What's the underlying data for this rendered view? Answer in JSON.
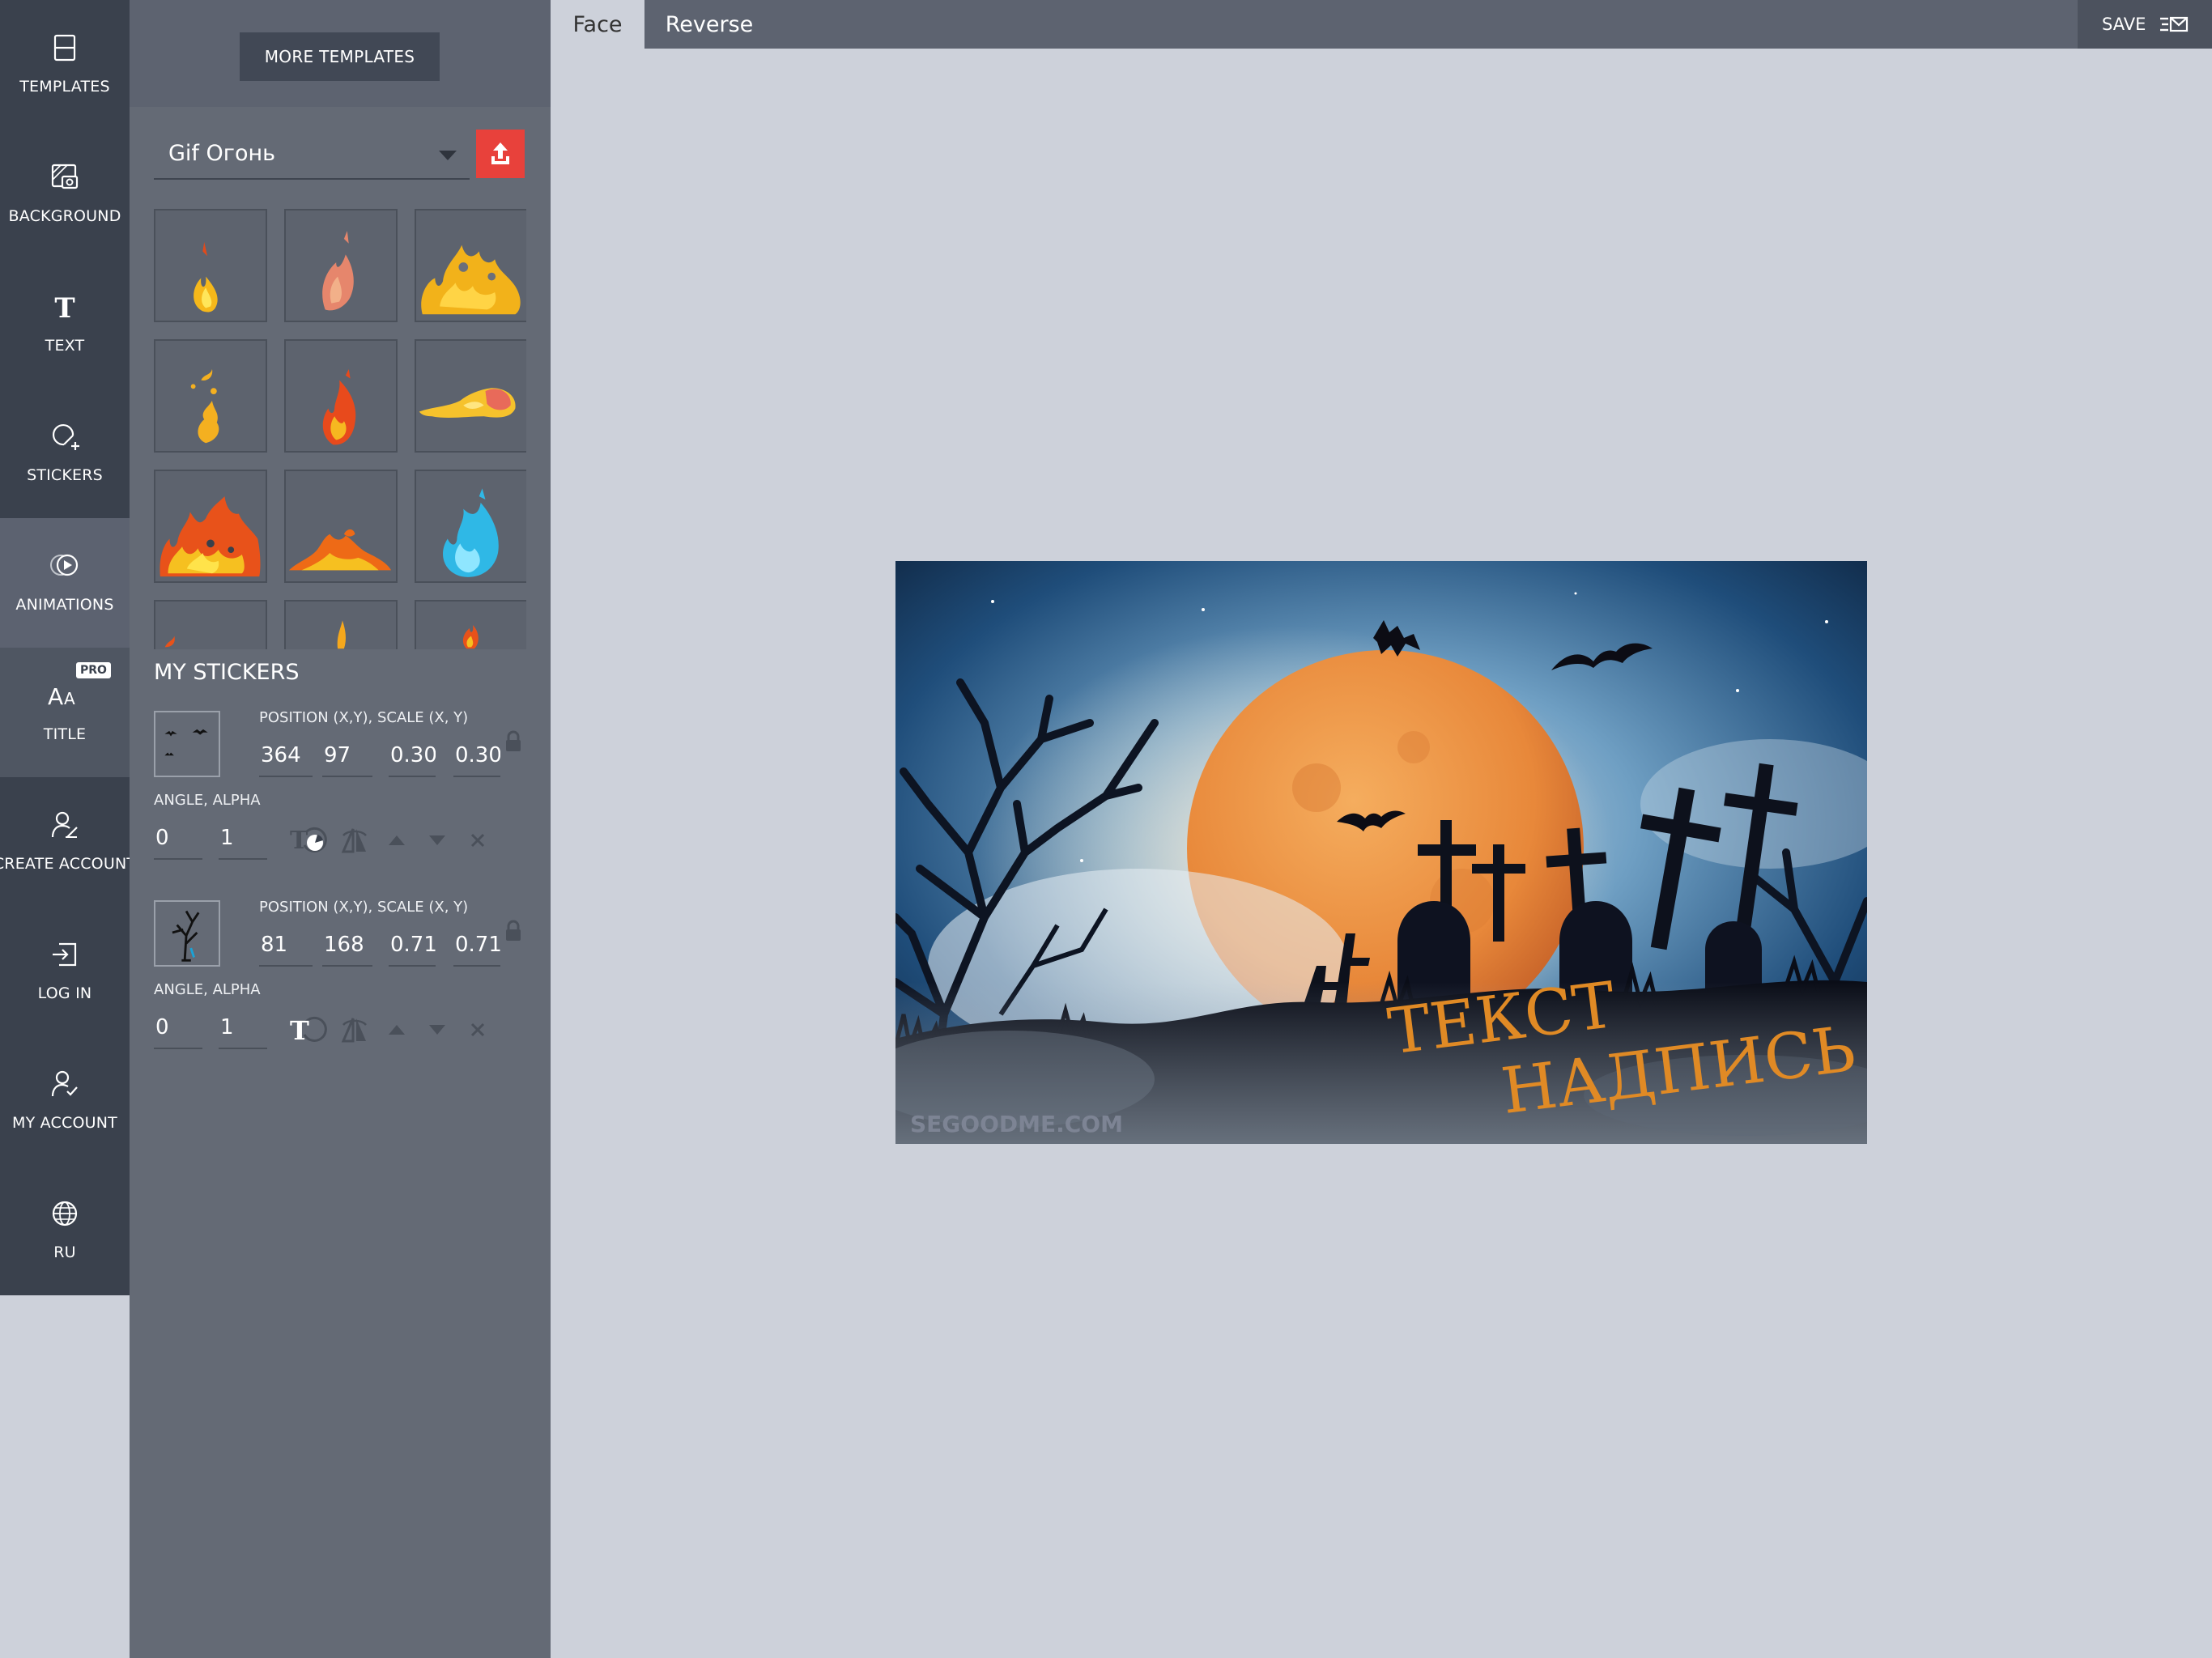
{
  "rail": {
    "items": [
      {
        "label": "TEMPLATES",
        "icon": "templates-icon"
      },
      {
        "label": "BACKGROUND",
        "icon": "background-icon"
      },
      {
        "label": "TEXT",
        "icon": "text-icon"
      },
      {
        "label": "STICKERS",
        "icon": "stickers-icon"
      },
      {
        "label": "ANIMATIONS",
        "icon": "animations-icon",
        "active": true
      },
      {
        "label": "TITLE",
        "icon": "title-icon",
        "badge": "PRO"
      },
      {
        "label": "CREATE ACCOUNT",
        "icon": "create-account-icon"
      },
      {
        "label": "LOG IN",
        "icon": "login-icon"
      },
      {
        "label": "MY ACCOUNT",
        "icon": "my-account-icon"
      },
      {
        "label": "RU",
        "icon": "globe-icon"
      }
    ]
  },
  "panel": {
    "more_templates": "MORE TEMPLATES",
    "category": "Gif Огонь",
    "upload_icon": "upload-icon",
    "thumbnails": [
      "fire-sticker-1",
      "fire-sticker-2",
      "fire-sticker-3",
      "fire-sticker-4",
      "fire-sticker-5",
      "fire-sticker-6",
      "fire-sticker-7",
      "fire-sticker-8",
      "fire-sticker-9",
      "fire-sticker-10",
      "fire-sticker-11",
      "fire-sticker-12"
    ],
    "my_stickers_title": "MY STICKERS",
    "stickers": [
      {
        "preview": "bats-sticker",
        "pos_label": "POSITION (X,Y), SCALE (X, Y)",
        "x": "364",
        "y": "97",
        "sx": "0.30",
        "sy": "0.30",
        "angle_label": "ANGLE, ALPHA",
        "angle": "0",
        "alpha": "1",
        "type_icon": "sticker-image-icon"
      },
      {
        "preview": "tree-sticker",
        "pos_label": "POSITION (X,Y), SCALE (X, Y)",
        "x": "81",
        "y": "168",
        "sx": "0.71",
        "sy": "0.71",
        "angle_label": "ANGLE, ALPHA",
        "angle": "0",
        "alpha": "1",
        "type_icon": "text-type-icon"
      }
    ]
  },
  "topbar": {
    "tabs": [
      "Face",
      "Reverse"
    ],
    "save": "SAVE"
  },
  "card": {
    "line1": "ТЕКСТ",
    "line2": "НАДПИСЬ",
    "watermark": "SEGOODME.COM"
  },
  "colors": {
    "rail_bg": "#3a414d",
    "panel_bg": "#646a75",
    "upload_red": "#e8413b",
    "workspace_bg": "#cdd1da",
    "card_text": "#e08a25"
  }
}
